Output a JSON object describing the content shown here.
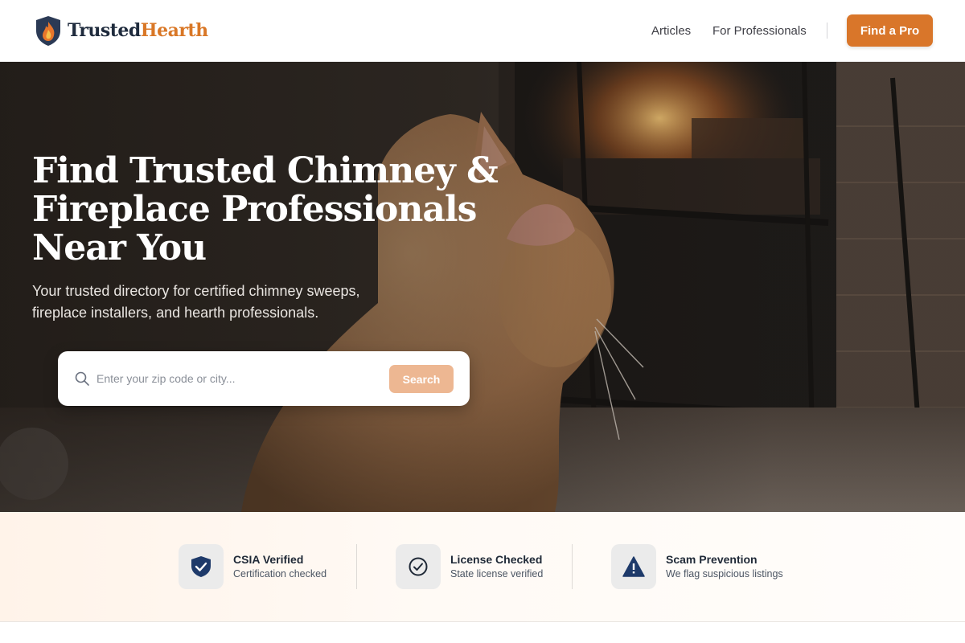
{
  "header": {
    "logo": {
      "part1": "Trusted",
      "part2": "Hearth",
      "icon": "flame-shield-icon"
    },
    "nav": [
      {
        "label": "Articles"
      },
      {
        "label": "For Professionals"
      }
    ],
    "cta_label": "Find a Pro"
  },
  "hero": {
    "title_lines": [
      "Find Trusted Chimney &",
      "Fireplace Professionals",
      "Near You"
    ],
    "subtitle_lines": [
      "Your trusted directory for certified chimney sweeps,",
      "fireplace installers, and hearth professionals."
    ],
    "search": {
      "placeholder": "Enter your zip code or city...",
      "value": "",
      "button_label": "Search",
      "icon": "search-icon"
    }
  },
  "trust": [
    {
      "title": "CSIA Verified",
      "desc": "Certification checked",
      "icon": "shield-check-icon"
    },
    {
      "title": "License Checked",
      "desc": "State license verified",
      "icon": "circle-check-icon"
    },
    {
      "title": "Scam Prevention",
      "desc": "We flag suspicious listings",
      "icon": "warning-triangle-icon"
    }
  ],
  "colors": {
    "accent": "#d9762a",
    "accent_light": "#edb792",
    "navy": "#1f2b3d"
  }
}
